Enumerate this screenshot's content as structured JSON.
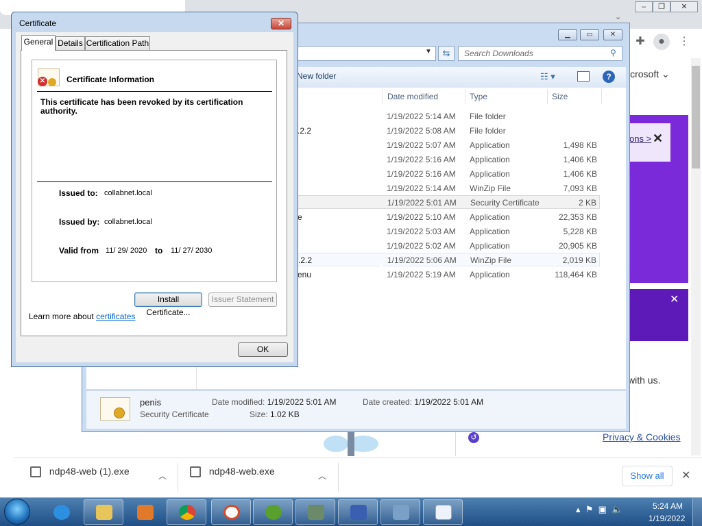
{
  "chrome": {
    "toolbar_icons": [
      "extension-icon",
      "profile-icon",
      "menu-icon"
    ],
    "page": {
      "header_fragment": "icrosoft",
      "banner_link": "ons >",
      "with_us": "with us.",
      "privacy_link": "Privacy & Cookies"
    },
    "downloads": [
      {
        "name": "ndp48-web (1).exe"
      },
      {
        "name": "ndp48-web.exe"
      }
    ],
    "show_all": "Show all"
  },
  "explorer": {
    "search_placeholder": "Search Downloads",
    "new_folder": "New folder",
    "columns": {
      "date": "Date modified",
      "type": "Type",
      "size": "Size"
    },
    "rows": [
      {
        "name": "",
        "date": "1/19/2022 5:14 AM",
        "type": "File folder",
        "size": ""
      },
      {
        "name": ".2.2",
        "date": "1/19/2022 5:08 AM",
        "type": "File folder",
        "size": ""
      },
      {
        "name": "",
        "date": "1/19/2022 5:07 AM",
        "type": "Application",
        "size": "1,498 KB"
      },
      {
        "name": "",
        "date": "1/19/2022 5:16 AM",
        "type": "Application",
        "size": "1,406 KB"
      },
      {
        "name": "",
        "date": "1/19/2022 5:16 AM",
        "type": "Application",
        "size": "1,406 KB"
      },
      {
        "name": "",
        "date": "1/19/2022 5:14 AM",
        "type": "WinZip File",
        "size": "7,093 KB"
      },
      {
        "name": "",
        "date": "1/19/2022 5:01 AM",
        "type": "Security Certificate",
        "size": "2 KB"
      },
      {
        "name": "e",
        "date": "1/19/2022 5:10 AM",
        "type": "Application",
        "size": "22,353 KB"
      },
      {
        "name": "",
        "date": "1/19/2022 5:03 AM",
        "type": "Application",
        "size": "5,228 KB"
      },
      {
        "name": "",
        "date": "1/19/2022 5:02 AM",
        "type": "Application",
        "size": "20,905 KB"
      },
      {
        "name": ".2.2",
        "date": "1/19/2022 5:06 AM",
        "type": "WinZip File",
        "size": "2,019 KB"
      },
      {
        "name": "enu",
        "date": "1/19/2022 5:19 AM",
        "type": "Application",
        "size": "118,464 KB"
      }
    ],
    "details": {
      "filename": "penis",
      "filetype": "Security Certificate",
      "modified_label": "Date modified:",
      "modified_value": "1/19/2022 5:01 AM",
      "created_label": "Date created:",
      "created_value": "1/19/2022 5:01 AM",
      "size_label": "Size:",
      "size_value": "1.02 KB"
    }
  },
  "certificate": {
    "title": "Certificate",
    "tabs": [
      "General",
      "Details",
      "Certification Path"
    ],
    "info_title": "Certificate Information",
    "message": "This certificate has been revoked by its certification authority.",
    "issued_to_label": "Issued to:",
    "issued_to": "collabnet.local",
    "issued_by_label": "Issued by:",
    "issued_by": "collabnet.local",
    "valid_from_label": "Valid from",
    "valid_from": "11/ 29/ 2020",
    "to_label": "to",
    "valid_to": "11/ 27/ 2030",
    "install_button": "Install Certificate...",
    "issuer_button": "Issuer Statement",
    "learn_prefix": "Learn more about ",
    "learn_link": "certificates",
    "ok_button": "OK"
  },
  "taskbar": {
    "time": "5:24 AM",
    "date": "1/19/2022",
    "apps": [
      "internet-explorer",
      "file-explorer",
      "media-player",
      "chrome",
      "app-5",
      "utorrent",
      "app-7",
      "app-8",
      "app-9",
      "notepad"
    ]
  }
}
